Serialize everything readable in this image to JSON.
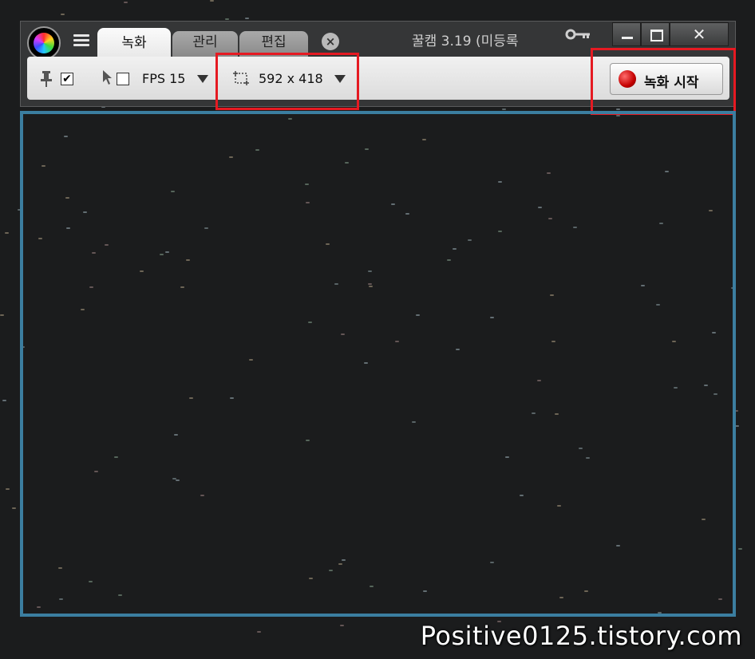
{
  "app": {
    "title": "꿀캠 3.19 (미등록"
  },
  "tabs": [
    {
      "label": "녹화",
      "active": true
    },
    {
      "label": "관리",
      "active": false
    },
    {
      "label": "편집",
      "active": false
    }
  ],
  "toolbar": {
    "pin_checked": true,
    "cursor_checked": false,
    "fps_value": "FPS 15",
    "region_size": "592 x 418",
    "record_label": "녹화 시작"
  },
  "window_buttons": {
    "close_glyph": "✕"
  },
  "watermark": "Positive0125.tistory.com",
  "colors": {
    "highlight": "#e51a22",
    "capture_border": "#3b7ea0",
    "record_dot": "#c40000"
  }
}
